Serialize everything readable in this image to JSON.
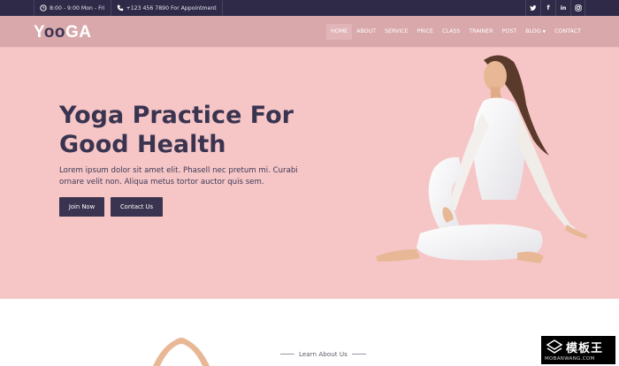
{
  "topbar": {
    "hours": "8:00 - 9:00 Mon - Fri",
    "phone": "+123 456 7890 For Appointment",
    "social": [
      {
        "name": "twitter-icon"
      },
      {
        "name": "facebook-icon",
        "glyph": "f"
      },
      {
        "name": "linkedin-icon",
        "glyph": "in"
      },
      {
        "name": "instagram-icon"
      }
    ]
  },
  "header": {
    "logo": {
      "part1": "Y",
      "part2": "oo",
      "part3": "GA"
    },
    "nav": [
      {
        "label": "HOME",
        "active": true
      },
      {
        "label": "ABOUT"
      },
      {
        "label": "SERVICE"
      },
      {
        "label": "PRICE"
      },
      {
        "label": "CLASS"
      },
      {
        "label": "TRAINER"
      },
      {
        "label": "POST"
      },
      {
        "label": "BLOG"
      },
      {
        "label": "CONTACT"
      }
    ]
  },
  "hero": {
    "title_line1": "Yoga Practice For",
    "title_line2": "Good Health",
    "text": "Lorem ipsum dolor sit amet elit. Phasell nec pretum mi. Curabi ornare velit non. Aliqua metus tortor auctor quis sem.",
    "join_label": "Join Now",
    "contact_label": "Contact Us"
  },
  "about": {
    "label": "Learn About Us"
  },
  "watermark": {
    "cn": "模板王",
    "en": "MOBANWANG.COM"
  },
  "colors": {
    "topbar": "#2e2a47",
    "header": "#d9a8ab",
    "hero_bg": "#f6c6c7",
    "dark_accent": "#3a3450"
  }
}
